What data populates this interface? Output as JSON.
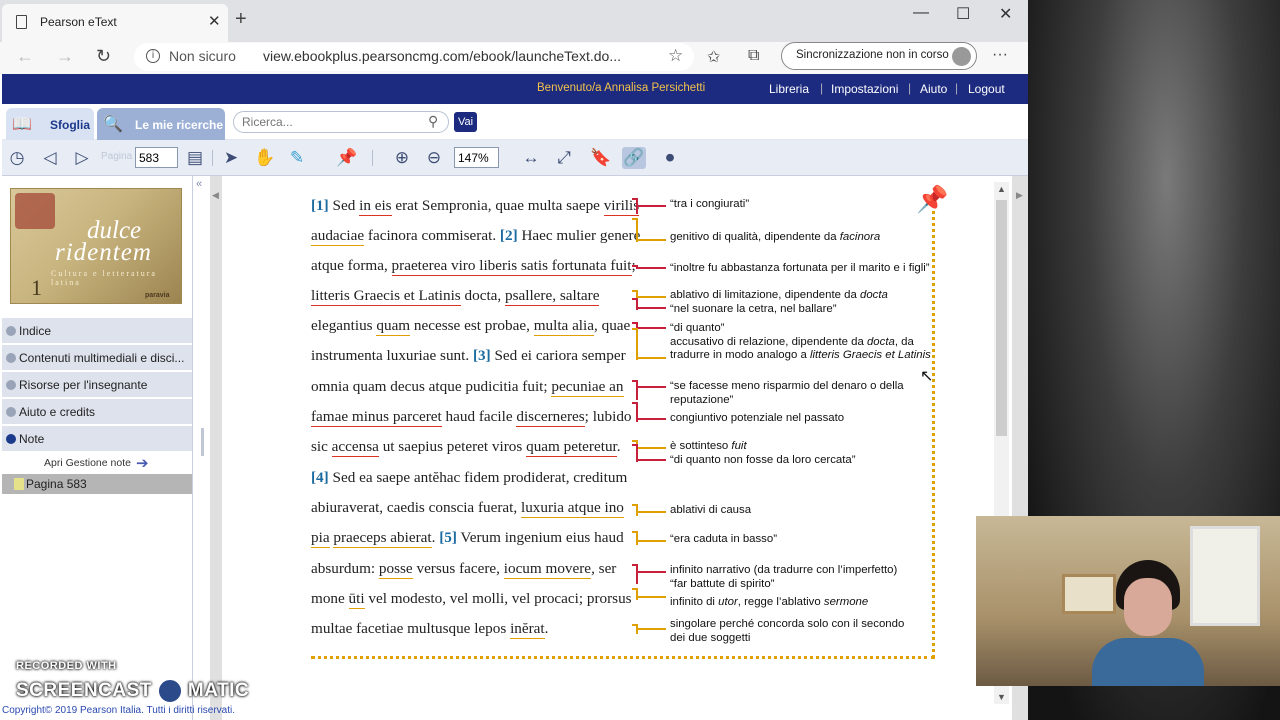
{
  "browser": {
    "tab_title": "Pearson eText",
    "tab_close": "✕",
    "new_tab": "+",
    "not_secure": "Non sicuro",
    "url": "view.ebookplus.pearsoncmg.com/ebook/launcheText.do...",
    "sync_label": "Sincronizzazione non in corso",
    "more": "···",
    "min": "—",
    "max": "☐",
    "close": "✕"
  },
  "header": {
    "welcome": "Benvenuto/a  Annalisa Persichetti",
    "links": [
      "Libreria",
      "Impostazioni",
      "Aiuto",
      "Logout"
    ],
    "sep": "|"
  },
  "search": {
    "tab_browse": "Sfoglia",
    "tab_searches": "Le mie ricerche",
    "placeholder": "Ricerca...",
    "go": "Vai"
  },
  "toolbar": {
    "page_label": "Pagina",
    "page_value": "583",
    "zoom_value": "147%"
  },
  "cover": {
    "title1": "dulce",
    "title2": "ridentem",
    "subtitle": "Cultura e letteratura latina",
    "volume": "1",
    "publisher": "paravia"
  },
  "sidebar": {
    "items": [
      "Indice",
      "Contenuti multimediali e disci...",
      "Risorse per l'insegnante",
      "Aiuto e credits",
      "Note"
    ],
    "notes_manage": "Apri Gestione note",
    "note_page": "Pagina 583"
  },
  "text": {
    "lines": [
      {
        "ref": "[1]",
        "parts": [
          "Sed ",
          {
            "u": "in eis"
          },
          " erat Sempronia, quae multa saepe ",
          {
            "u": "virilis"
          }
        ]
      },
      {
        "ref": "",
        "parts": [
          {
            "u": "audaciae"
          },
          " facinora commiserat. ",
          {
            "ref": "[2]"
          },
          " Haec mulier genere"
        ]
      },
      {
        "ref": "",
        "parts": [
          "atque forma, ",
          {
            "u": "praeterea viro liberis satis fortunata fuit"
          },
          ";"
        ]
      },
      {
        "ref": "",
        "parts": [
          {
            "u": "litteris Graecis et Latinis"
          },
          " docta, ",
          {
            "u": "psallere, saltare"
          }
        ]
      },
      {
        "ref": "",
        "parts": [
          "elegantius ",
          {
            "u": "quam"
          },
          " necesse est probae, ",
          {
            "u": "multa alia"
          },
          ", quae"
        ]
      },
      {
        "ref": "",
        "parts": [
          "instrumenta luxuriae sunt. ",
          {
            "ref": "[3]"
          },
          " Sed ei cariora semper"
        ]
      },
      {
        "ref": "",
        "parts": [
          "omnia quam decus atque pudicitia fuit; ",
          {
            "u": "pecuniae an"
          }
        ]
      },
      {
        "ref": "",
        "parts": [
          {
            "u": "famae minus parceret"
          },
          " haud facile ",
          {
            "u": "discerneres"
          },
          "; lubido"
        ]
      },
      {
        "ref": "",
        "parts": [
          "sic ",
          {
            "u": "accensa"
          },
          " ut saepius peteret viros ",
          {
            "u": "quam peteretur"
          },
          "."
        ]
      },
      {
        "ref": "[4]",
        "parts": [
          "Sed ea saepe antĕhac fidem prodiderat, creditum"
        ]
      },
      {
        "ref": "",
        "parts": [
          "abiuraverat, caedis conscia fuerat, ",
          {
            "u": "luxuria atque ino"
          }
        ]
      },
      {
        "ref": "",
        "parts": [
          {
            "u": "pia"
          },
          " ",
          {
            "u": "praeceps abierat"
          },
          ". ",
          {
            "ref": "[5]"
          },
          " Verum ingenium eius haud"
        ]
      },
      {
        "ref": "",
        "parts": [
          "absurdum: ",
          {
            "u": "posse"
          },
          " versus facere, ",
          {
            "u": "iocum movere"
          },
          ", ser"
        ]
      },
      {
        "ref": "",
        "parts": [
          "mone ",
          {
            "u": "ūti"
          },
          " vel modesto, vel molli, vel procaci; prorsus"
        ]
      },
      {
        "ref": "",
        "parts": [
          "multae facetiae multusque lepos ",
          {
            "u": "inĕrat"
          },
          "."
        ]
      }
    ],
    "glosses": [
      "“tra i congiurati”",
      "genitivo di qualità, dipendente da <i>facinora</i>",
      "“inoltre fu abbastanza fortunata per il marito e i figli”",
      "ablativo di limitazione, dipendente da <i>docta</i><br>“nel suonare la cetra, nel ballare”",
      "“di quanto”<br>accusativo di relazione, dipendente da <i>docta</i>, da<br>tradurre in modo analogo a <i>litteris Graecis et Latinis</i>",
      "“se facesse meno risparmio del denaro o della<br>reputazione”",
      "congiuntivo potenziale nel passato",
      "è sottinteso <i>fuit</i><br>“di quanto non fosse da loro cercata”",
      "ablativi di causa",
      "“era caduta in basso”",
      "infinito narrativo (da tradurre con l’imperfetto)<br>“far battute di spirito”",
      "infinito di <i>utor</i>, regge l’ablativo <i>sermone</i>",
      "singolare perché concorda solo con il secondo<br>dei due soggetti"
    ]
  },
  "footer": {
    "copyright": "Copyright© 2019 Pearson Italia. Tutti i diritti riservati.",
    "watermark_top": "RECORDED WITH",
    "watermark_left": "SCREENCAST",
    "watermark_right": "MATIC"
  },
  "colors": {
    "header_bg": "#1c2a80",
    "welcome": "#f2c24a",
    "red_bracket": "#c8203a",
    "yellow_bracket": "#e0a000",
    "ref": "#1b6aa0"
  }
}
